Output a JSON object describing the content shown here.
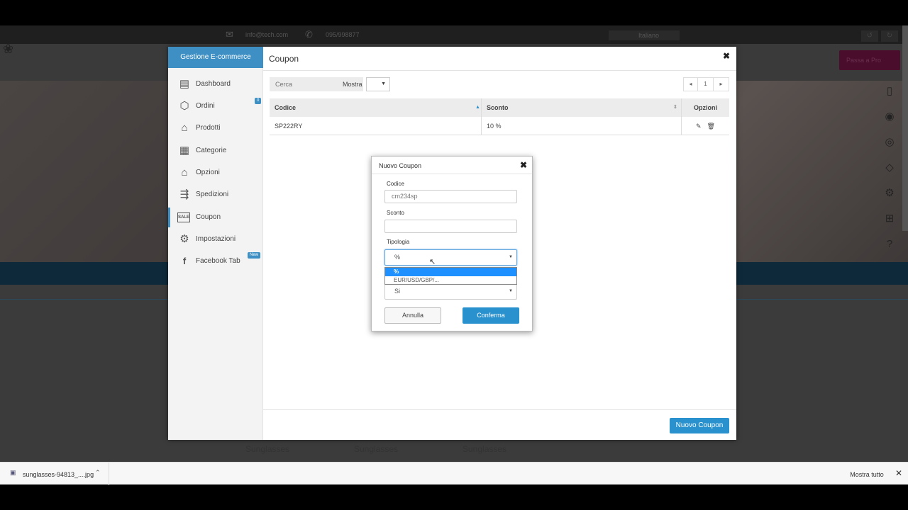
{
  "bg": {
    "email": "info@tech.com",
    "phone": "095/998877",
    "language": "Italiano",
    "pro_button": "Passa a Pro",
    "products": [
      "Sunglasses",
      "Sunglasses",
      "Sunglasses"
    ]
  },
  "sidebar": {
    "title": "Gestione E-commerce",
    "items": [
      {
        "label": "Dashboard",
        "icon": "dashboard-icon"
      },
      {
        "label": "Ordini",
        "icon": "box-icon",
        "badge": "0"
      },
      {
        "label": "Prodotti",
        "icon": "basket-icon"
      },
      {
        "label": "Categorie",
        "icon": "clipboard-icon"
      },
      {
        "label": "Opzioni",
        "icon": "basket-icon"
      },
      {
        "label": "Spedizioni",
        "icon": "shipping-icon"
      },
      {
        "label": "Coupon",
        "icon": "sale-tag-icon",
        "active": true
      },
      {
        "label": "Impostazioni",
        "icon": "gear-icon"
      },
      {
        "label": "Facebook Tab",
        "icon": "facebook-icon",
        "badge": "New"
      }
    ]
  },
  "main": {
    "title": "Coupon",
    "search_placeholder": "Cerca",
    "show_label": "Mostra",
    "page": "1",
    "columns": [
      "Codice",
      "Sconto",
      "Opzioni"
    ],
    "rows": [
      {
        "code": "SP222RY",
        "discount": "10 %"
      }
    ],
    "new_coupon_label": "Nuovo Coupon"
  },
  "dialog": {
    "title": "Nuovo Coupon",
    "code_label": "Codice",
    "code_value": "cm234sp",
    "discount_label": "Sconto",
    "discount_value": "",
    "type_label": "Tipologia",
    "type_value": "%",
    "type_options": [
      "%",
      "EUR/USD/GBP/..."
    ],
    "active_value": "Si",
    "cancel_label": "Annulla",
    "confirm_label": "Conferma"
  },
  "downloads": {
    "file_name": "sunglasses-94813_....jpg",
    "show_all_label": "Mostra tutto"
  },
  "colors": {
    "accent": "#2a91cf",
    "sidebar_title": "#3d8fc4",
    "selected_option": "#1e90ff"
  }
}
